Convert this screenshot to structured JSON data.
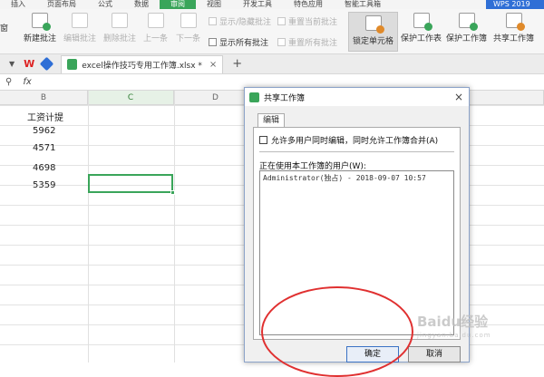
{
  "menu": {
    "tabs": [
      "插入",
      "页面布局",
      "公式",
      "数据",
      "审阅",
      "视图",
      "开发工具",
      "特色应用",
      "智能工具箱"
    ],
    "active_tab": "审阅",
    "brand": "WPS 2019"
  },
  "ribbon": {
    "left_cut_label": "窗",
    "new_comment": "新建批注",
    "edit_comment": "编辑批注",
    "delete_comment": "删除批注",
    "prev": "上一条",
    "next": "下一条",
    "show_hide_comments": "显示/隐藏批注",
    "reset_current_comment": "重置当前批注",
    "show_all_comments": "显示所有批注",
    "reset_all_comments": "重置所有批注",
    "lock_cell": "锁定单元格",
    "protect_sheet": "保护工作表",
    "protect_workbook": "保护工作簿",
    "share_workbook": "共享工作簿"
  },
  "tabbar": {
    "filename": "excel操作技巧专用工作簿.xlsx *",
    "close": "×",
    "add": "+"
  },
  "formula_bar": {
    "zoom_icon": "magnifier-icon",
    "fx": "fx"
  },
  "grid": {
    "columns": [
      "B",
      "C",
      "D"
    ],
    "selected_column": "C",
    "header_cell": "工资计提",
    "values": [
      "5962",
      "4571",
      "4698",
      "5359"
    ]
  },
  "dialog": {
    "title": "共享工作簿",
    "close": "×",
    "tab": "编辑",
    "allow_multi_user_label": "允许多用户同时编辑，同时允许工作簿合并(A)",
    "allow_multi_user_checked": false,
    "users_label": "正在使用本工作簿的用户(W):",
    "users": [
      "Administrator(独占) - 2018-09-07 10:57"
    ],
    "ok": "确定",
    "cancel": "取消"
  },
  "watermark": {
    "text": "Baidu经验",
    "sub": "jingyan.baidu.com"
  },
  "colors": {
    "accent_green": "#3aa55a",
    "brand_blue": "#2f6fd6",
    "annotation_red": "#e03030"
  }
}
